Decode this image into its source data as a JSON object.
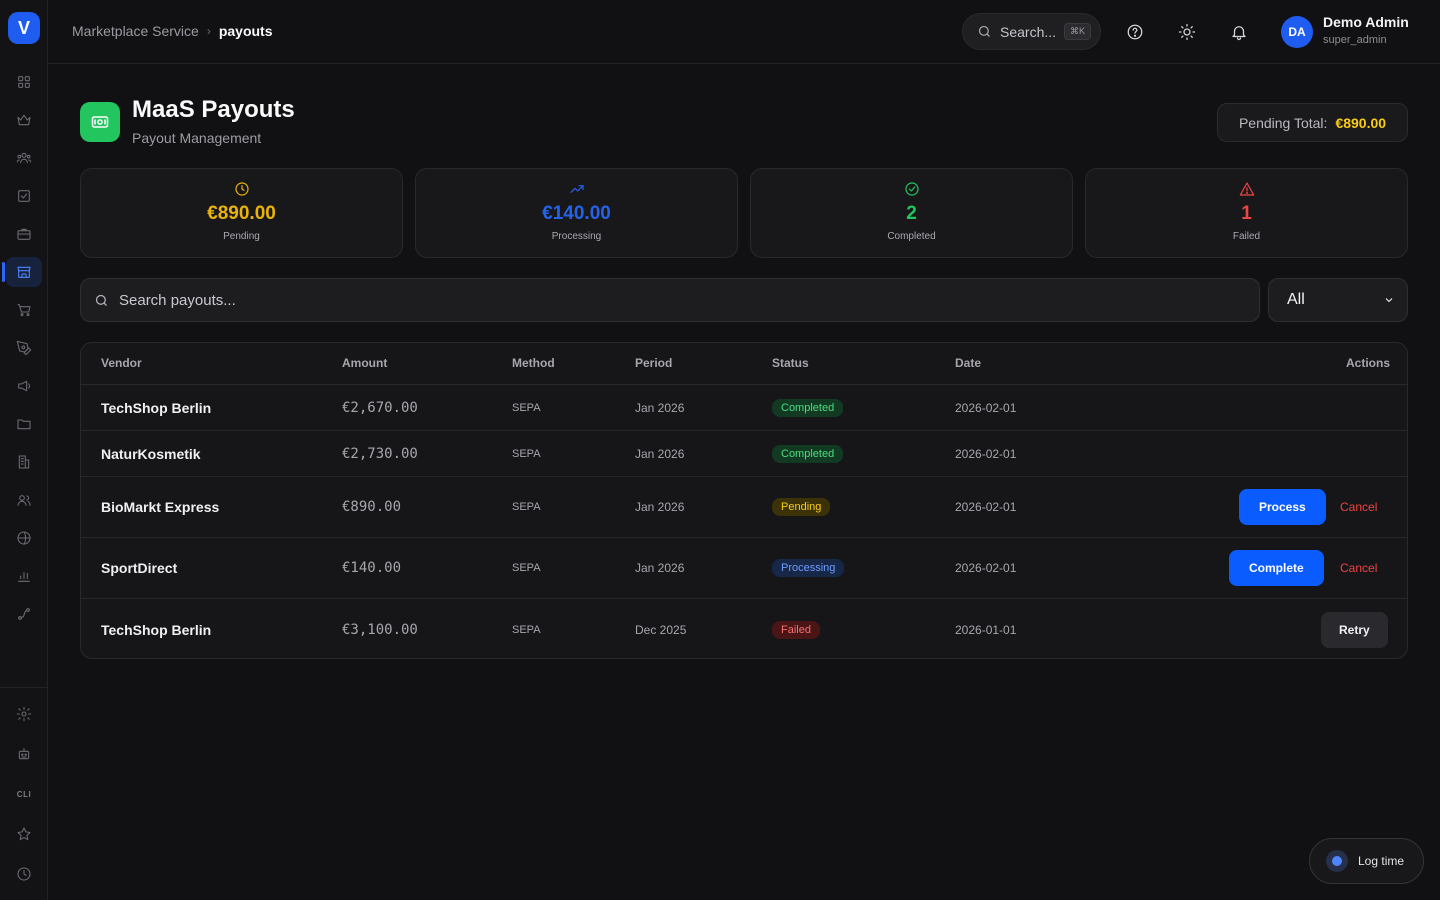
{
  "app": {
    "logo_letter": "V"
  },
  "sidebar": {
    "items": [
      {
        "icon": "dashboard-icon"
      },
      {
        "icon": "crown-icon"
      },
      {
        "icon": "users-group-icon"
      },
      {
        "icon": "checkbox-icon"
      },
      {
        "icon": "briefcase-icon"
      },
      {
        "icon": "store-icon",
        "active": true
      },
      {
        "icon": "cart-icon"
      },
      {
        "icon": "pen-tool-icon"
      },
      {
        "icon": "megaphone-icon"
      },
      {
        "icon": "folder-icon"
      },
      {
        "icon": "building-icon"
      },
      {
        "icon": "contacts-icon"
      },
      {
        "icon": "globe-icon"
      },
      {
        "icon": "bar-chart-icon"
      },
      {
        "icon": "route-icon"
      }
    ],
    "bottom_items": [
      {
        "icon": "settings-icon"
      },
      {
        "icon": "robot-icon"
      },
      {
        "label": "CLI"
      },
      {
        "icon": "star-icon"
      },
      {
        "icon": "clock-icon"
      }
    ]
  },
  "header": {
    "breadcrumb": {
      "parent": "Marketplace Service",
      "separator": "›",
      "current": "payouts"
    },
    "search": {
      "placeholder": "Search...",
      "shortcut": "⌘K"
    },
    "user": {
      "initials": "DA",
      "name": "Demo Admin",
      "role": "super_admin"
    }
  },
  "page": {
    "title": "MaaS Payouts",
    "subtitle": "Payout Management",
    "pending_total": {
      "label": "Pending Total:",
      "value": "€890.00"
    }
  },
  "stats": [
    {
      "value": "€890.00",
      "label": "Pending",
      "icon": "clock-icon",
      "color": "#eab308"
    },
    {
      "value": "€140.00",
      "label": "Processing",
      "icon": "trending-up-icon",
      "color": "#2563eb"
    },
    {
      "value": "2",
      "label": "Completed",
      "icon": "check-circle-icon",
      "color": "#22c55e"
    },
    {
      "value": "1",
      "label": "Failed",
      "icon": "alert-triangle-icon",
      "color": "#ef4444"
    }
  ],
  "filters": {
    "search_placeholder": "Search payouts...",
    "status_selected": "All"
  },
  "table": {
    "columns": [
      "Vendor",
      "Amount",
      "Method",
      "Period",
      "Status",
      "Date",
      "Actions"
    ],
    "rows": [
      {
        "vendor": "TechShop Berlin",
        "amount": "€2,670.00",
        "method": "SEPA",
        "period": "Jan 2026",
        "status": "Completed",
        "date": "2026-02-01",
        "actions": []
      },
      {
        "vendor": "NaturKosmetik",
        "amount": "€2,730.00",
        "method": "SEPA",
        "period": "Jan 2026",
        "status": "Completed",
        "date": "2026-02-01",
        "actions": []
      },
      {
        "vendor": "BioMarkt Express",
        "amount": "€890.00",
        "method": "SEPA",
        "period": "Jan 2026",
        "status": "Pending",
        "date": "2026-02-01",
        "actions": [
          "Process",
          "Cancel"
        ]
      },
      {
        "vendor": "SportDirect",
        "amount": "€140.00",
        "method": "SEPA",
        "period": "Jan 2026",
        "status": "Processing",
        "date": "2026-02-01",
        "actions": [
          "Complete",
          "Cancel"
        ]
      },
      {
        "vendor": "TechShop Berlin",
        "amount": "€3,100.00",
        "method": "SEPA",
        "period": "Dec 2025",
        "status": "Failed",
        "date": "2026-01-01",
        "actions": [
          "Retry"
        ]
      }
    ]
  },
  "log_time": {
    "label": "Log time"
  },
  "colors": {
    "accent": "#0b5cff",
    "success": "#22c55e",
    "warning": "#facc15",
    "danger": "#ef4444",
    "background": "#111113"
  }
}
